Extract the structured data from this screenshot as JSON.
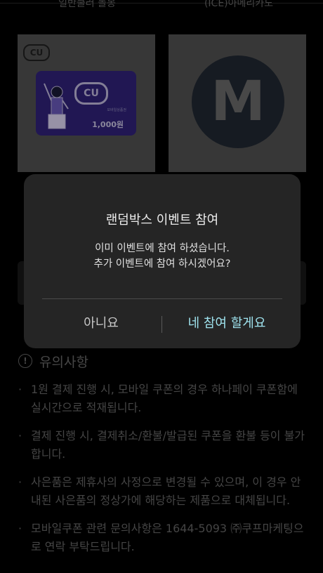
{
  "products": [
    {
      "name": "일반쿨러 돌봉"
    },
    {
      "name": "(ICE)아메리카노"
    }
  ],
  "giftcard": {
    "brand": "CU",
    "amount": "1,000원",
    "subtext": "모바일상품권"
  },
  "m_logo": "M",
  "notice": {
    "icon": "!",
    "title": "유의사항",
    "items": [
      "1원 결제 진행 시, 모바일 쿠폰의 경우 하나페이 쿠폰함에 실시간으로 적재됩니다.",
      "결제 진행 시, 결제취소/환불/발급된 쿠폰을 환불 등이 불가합니다.",
      "사은품은 제휴사의 사정으로 변경될 수 있으며, 이 경우 안내된 사은품의 정상가에 해당하는 제품으로 대체됩니다.",
      "모바일쿠폰 관련 문의사항은 1644-5093 ㈜쿠프마케팅으로 연락 부탁드립니다."
    ]
  },
  "dialog": {
    "title": "랜덤박스 이벤트 참여",
    "line1": "이미 이벤트에 참여 하셨습니다.",
    "line2": "추가 이벤트에 참여 하시겠어요?",
    "no_label": "아니요",
    "yes_label": "네 참여 할게요"
  },
  "colors": {
    "accent": "#9fe3ee",
    "dialog_bg": "#252525",
    "gift_bg": "#332480"
  }
}
